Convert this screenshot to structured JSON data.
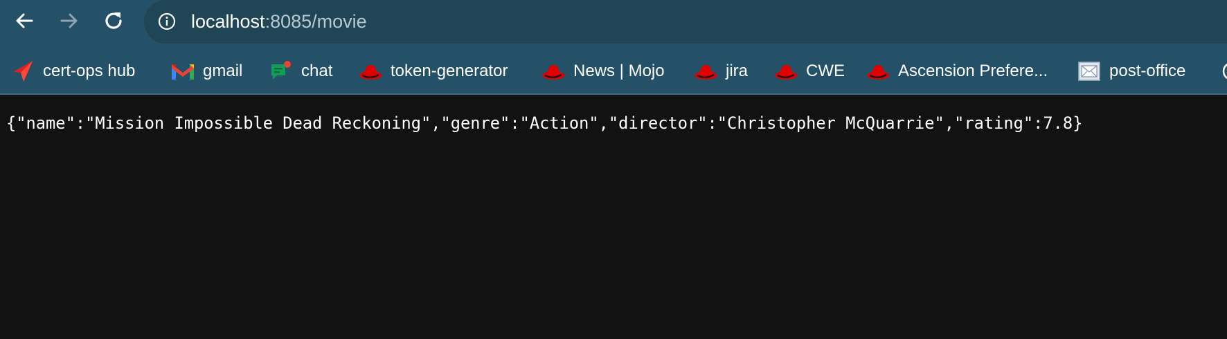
{
  "browser": {
    "nav": {
      "back": "back-arrow",
      "forward": "forward-arrow",
      "reload": "reload"
    },
    "address": {
      "host": "localhost",
      "rest": ":8085/movie"
    },
    "bookmarks": [
      {
        "label": "cert-ops hub",
        "icon": "red-arrow-icon"
      },
      {
        "label": "gmail",
        "icon": "gmail-icon"
      },
      {
        "label": "chat",
        "icon": "chat-icon"
      },
      {
        "label": "token-generator",
        "icon": "redhat-icon"
      },
      {
        "label": "News | Mojo",
        "icon": "redhat-icon"
      },
      {
        "label": "jira",
        "icon": "redhat-icon"
      },
      {
        "label": "CWE",
        "icon": "redhat-icon"
      },
      {
        "label": "Ascension Prefere...",
        "icon": "redhat-icon"
      },
      {
        "label": "post-office",
        "icon": "mail-image-icon"
      }
    ]
  },
  "page": {
    "json_text": "{\"name\":\"Mission Impossible Dead Reckoning\",\"genre\":\"Action\",\"director\":\"Christopher McQuarrie\",\"rating\":7.8}"
  },
  "colors": {
    "chrome": "#245167",
    "omnibox": "#1f4556",
    "page_bg": "#121212",
    "redhat": "#e00000"
  }
}
